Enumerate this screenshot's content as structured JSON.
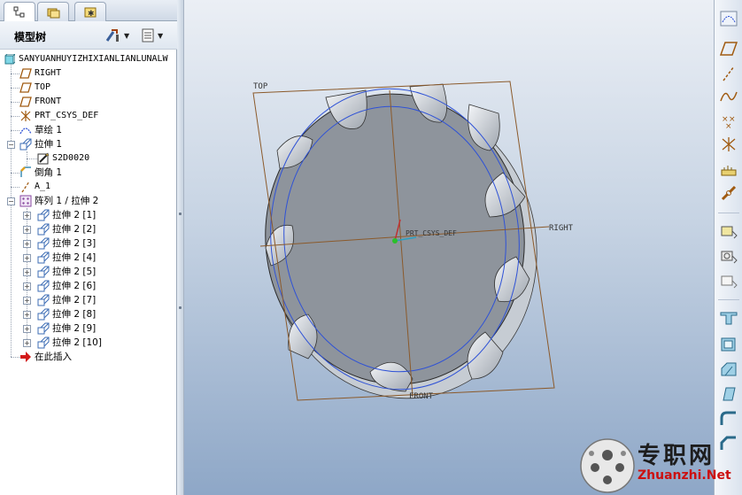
{
  "model_tree": {
    "header_title": "模型树",
    "items": [
      {
        "label": "SANYUANHUYIZHIXIANLIANLUNALW",
        "type": "part"
      },
      {
        "label": "RIGHT",
        "type": "datum-plane"
      },
      {
        "label": "TOP",
        "type": "datum-plane"
      },
      {
        "label": "FRONT",
        "type": "datum-plane"
      },
      {
        "label": "PRT_CSYS_DEF",
        "type": "csys"
      },
      {
        "label": "草绘 1",
        "type": "sketch"
      },
      {
        "label": "拉伸 1",
        "type": "extrude"
      },
      {
        "label": "S2D0020",
        "type": "sketch-child"
      },
      {
        "label": "倒角 1",
        "type": "chamfer"
      },
      {
        "label": "A_1",
        "type": "axis"
      },
      {
        "label": "阵列 1 / 拉伸 2",
        "type": "pattern"
      },
      {
        "label": "拉伸 2 [1]",
        "type": "extrude"
      },
      {
        "label": "拉伸 2 [2]",
        "type": "extrude"
      },
      {
        "label": "拉伸 2 [3]",
        "type": "extrude"
      },
      {
        "label": "拉伸 2 [4]",
        "type": "extrude"
      },
      {
        "label": "拉伸 2 [5]",
        "type": "extrude"
      },
      {
        "label": "拉伸 2 [6]",
        "type": "extrude"
      },
      {
        "label": "拉伸 2 [7]",
        "type": "extrude"
      },
      {
        "label": "拉伸 2 [8]",
        "type": "extrude"
      },
      {
        "label": "拉伸 2 [9]",
        "type": "extrude"
      },
      {
        "label": "拉伸 2 [10]",
        "type": "extrude"
      },
      {
        "label": "在此插入",
        "type": "insert-here"
      }
    ]
  },
  "graphics": {
    "datum_labels": {
      "top": "TOP",
      "right": "RIGHT",
      "front": "FRONT",
      "csys": "PRT_CSYS_DEF"
    },
    "colors": {
      "part": "#8e949c",
      "edge": "#2a2a2a",
      "datum_plane": "#8b5a2b",
      "sketch": "#2f52d6"
    }
  },
  "right_toolbar": {
    "icons": [
      "sketch-tool-icon",
      "datum-plane-icon",
      "datum-axis-icon",
      "datum-curve-icon",
      "datum-point-icon",
      "csys-icon",
      "analysis-icon",
      "chain-icon",
      "extrude-icon",
      "revolve-icon",
      "sweep-icon",
      "hole-icon",
      "shell-icon",
      "rib-icon",
      "draft-icon",
      "round-icon",
      "chamfer-icon"
    ]
  },
  "watermark": {
    "chinese": "专职网",
    "english": "Zhuanzhi.Net"
  }
}
